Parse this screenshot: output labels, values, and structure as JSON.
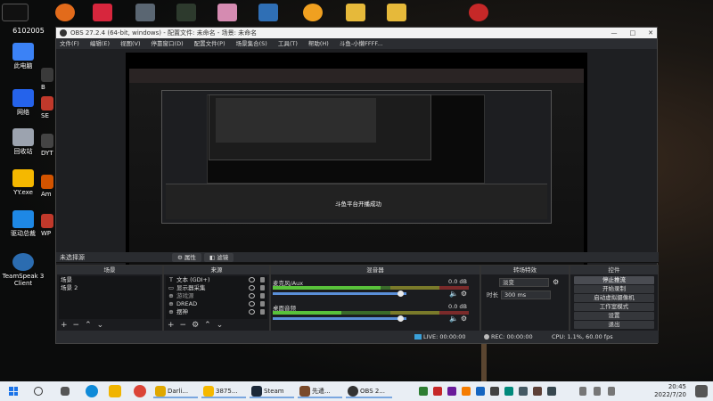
{
  "desktop": {
    "left_label": "6102005",
    "icons": [
      {
        "label": "此电脑",
        "color": "#3b82f6"
      },
      {
        "label": "网络",
        "color": "#2563eb"
      },
      {
        "label": "回收站",
        "color": "#9ca3af"
      },
      {
        "label": "YY.exe",
        "color": "#f5b800"
      },
      {
        "label": "驱动总裁",
        "color": "#1e88e5"
      },
      {
        "label": "TeamSpeak 3 Client",
        "color": "#2b6cb0"
      }
    ],
    "col2_labels": [
      "B",
      "SE",
      "DYT",
      "Am",
      "WP"
    ]
  },
  "obs": {
    "title": "OBS 27.2.4 (64-bit, windows) - 配置文件: 未命名 - 场景: 未命名",
    "menu": [
      "文件(F)",
      "编辑(E)",
      "视图(V)",
      "停靠窗口(D)",
      "配置文件(P)",
      "场景集合(S)",
      "工具(T)",
      "帮助(H)",
      "斗鱼-小懒FFFF..."
    ],
    "toast": "斗鱼平台开播成功",
    "no_source": "未选择源",
    "properties_label": "属性",
    "filters_label": "滤镜",
    "scenes_header": "场景",
    "scenes": [
      "场景",
      "场景 2"
    ],
    "sources_header": "来源",
    "sources": [
      {
        "icon": "T",
        "name": "文本 (GDI+)"
      },
      {
        "icon": "▭",
        "name": "显示器采集"
      },
      {
        "icon": "⊕",
        "name": "游戏源"
      },
      {
        "icon": "⊕",
        "name": "DREAD"
      },
      {
        "icon": "⊕",
        "name": "摆神"
      }
    ],
    "mixer_header": "混音器",
    "mixer": [
      {
        "name": "麦克风/Aux",
        "db": "0.0 dB",
        "level": 0.55,
        "volume": 0.96
      },
      {
        "name": "桌面音频",
        "db": "0.0 dB",
        "level": 0.35,
        "volume": 0.96
      }
    ],
    "transitions_header": "转场特效",
    "transition_value": "淡变",
    "duration_label": "时长",
    "duration_value": "300 ms",
    "controls_header": "控件",
    "controls": [
      "停止推流",
      "开始录制",
      "启动虚拟摄像机",
      "工作室模式",
      "设置",
      "退出"
    ],
    "status": {
      "live_label": "LIVE:",
      "live_time": "00:00:00",
      "rec_label": "REC:",
      "rec_time": "00:00:00",
      "cpu": "CPU: 1.1%, 60.00 fps"
    }
  },
  "taskbar": {
    "apps": [
      "Darli...",
      "3875...",
      "Steam",
      "先遣...",
      "OBS 2..."
    ],
    "time": "20:45",
    "date": "2022/7/20"
  }
}
